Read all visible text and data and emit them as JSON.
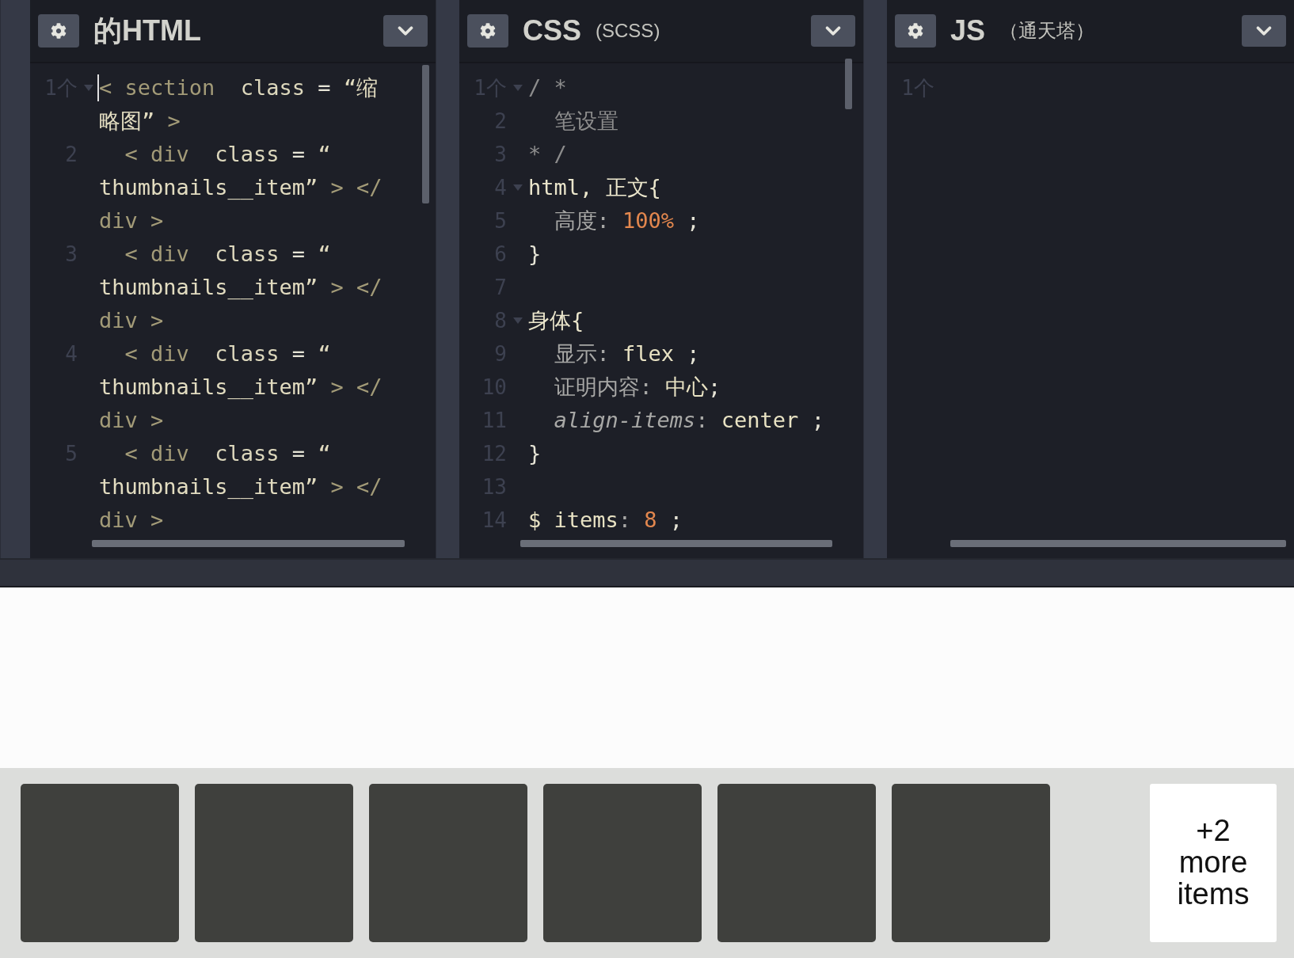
{
  "editors": [
    {
      "title": "的HTML",
      "lines": [
        {
          "number": "1个",
          "fold": true,
          "cursor": true,
          "rows": [
            {
              "segments": [
                {
                  "kind": "tag",
                  "text": "< section  "
                },
                {
                  "kind": "attr",
                  "text": "class"
                },
                {
                  "kind": "punct",
                  "text": " = "
                },
                {
                  "kind": "string",
                  "text": "“缩"
                }
              ]
            },
            {
              "segments": [
                {
                  "kind": "string",
                  "text": "略图”"
                },
                {
                  "kind": "tag",
                  "text": " >"
                }
              ]
            }
          ]
        },
        {
          "number": "2",
          "fold": false,
          "cursor": false,
          "rows": [
            {
              "segments": [
                {
                  "kind": "tag",
                  "text": "  < div  "
                },
                {
                  "kind": "attr",
                  "text": "class"
                },
                {
                  "kind": "punct",
                  "text": " = "
                },
                {
                  "kind": "string",
                  "text": "“"
                }
              ]
            },
            {
              "segments": [
                {
                  "kind": "string",
                  "text": "thumbnails__item”"
                },
                {
                  "kind": "tag",
                  "text": " > </"
                }
              ]
            },
            {
              "segments": [
                {
                  "kind": "tag",
                  "text": "div >"
                }
              ]
            }
          ]
        },
        {
          "number": "3",
          "fold": false,
          "cursor": false,
          "rows": [
            {
              "segments": [
                {
                  "kind": "tag",
                  "text": "  < div  "
                },
                {
                  "kind": "attr",
                  "text": "class"
                },
                {
                  "kind": "punct",
                  "text": " = "
                },
                {
                  "kind": "string",
                  "text": "“"
                }
              ]
            },
            {
              "segments": [
                {
                  "kind": "string",
                  "text": "thumbnails__item”"
                },
                {
                  "kind": "tag",
                  "text": " > </"
                }
              ]
            },
            {
              "segments": [
                {
                  "kind": "tag",
                  "text": "div >"
                }
              ]
            }
          ]
        },
        {
          "number": "4",
          "fold": false,
          "cursor": false,
          "rows": [
            {
              "segments": [
                {
                  "kind": "tag",
                  "text": "  < div  "
                },
                {
                  "kind": "attr",
                  "text": "class"
                },
                {
                  "kind": "punct",
                  "text": " = "
                },
                {
                  "kind": "string",
                  "text": "“"
                }
              ]
            },
            {
              "segments": [
                {
                  "kind": "string",
                  "text": "thumbnails__item”"
                },
                {
                  "kind": "tag",
                  "text": " > </"
                }
              ]
            },
            {
              "segments": [
                {
                  "kind": "tag",
                  "text": "div >"
                }
              ]
            }
          ]
        },
        {
          "number": "5",
          "fold": false,
          "cursor": false,
          "rows": [
            {
              "segments": [
                {
                  "kind": "tag",
                  "text": "  < div  "
                },
                {
                  "kind": "attr",
                  "text": "class"
                },
                {
                  "kind": "punct",
                  "text": " = "
                },
                {
                  "kind": "string",
                  "text": "“"
                }
              ]
            },
            {
              "segments": [
                {
                  "kind": "string",
                  "text": "thumbnails__item”"
                },
                {
                  "kind": "tag",
                  "text": " > </"
                }
              ]
            },
            {
              "segments": [
                {
                  "kind": "tag",
                  "text": "div >"
                }
              ]
            }
          ]
        }
      ]
    },
    {
      "title": "CSS",
      "subtitle": "(SCSS)",
      "lines": [
        {
          "number": "1个",
          "fold": true,
          "cursor": false,
          "rows": [
            {
              "segments": [
                {
                  "kind": "comment",
                  "text": "/ *"
                }
              ]
            }
          ]
        },
        {
          "number": "2",
          "fold": false,
          "cursor": false,
          "rows": [
            {
              "segments": [
                {
                  "kind": "comment",
                  "text": "  笔设置"
                }
              ]
            }
          ]
        },
        {
          "number": "3",
          "fold": false,
          "cursor": false,
          "rows": [
            {
              "segments": [
                {
                  "kind": "comment",
                  "text": "* /"
                }
              ]
            }
          ]
        },
        {
          "number": "4",
          "fold": true,
          "cursor": false,
          "rows": [
            {
              "segments": [
                {
                  "kind": "selector",
                  "text": "html, 正文{"
                }
              ]
            }
          ]
        },
        {
          "number": "5",
          "fold": false,
          "cursor": false,
          "rows": [
            {
              "segments": [
                {
                  "kind": "property",
                  "text": "  高度: "
                },
                {
                  "kind": "number",
                  "text": "100%"
                },
                {
                  "kind": "punct",
                  "text": " ;"
                }
              ]
            }
          ]
        },
        {
          "number": "6",
          "fold": false,
          "cursor": false,
          "rows": [
            {
              "segments": [
                {
                  "kind": "punct",
                  "text": "}"
                }
              ]
            }
          ]
        },
        {
          "number": "7",
          "fold": false,
          "cursor": false
        },
        {
          "number": "8",
          "fold": true,
          "cursor": false,
          "rows": [
            {
              "segments": [
                {
                  "kind": "selector",
                  "text": "身体{"
                }
              ]
            }
          ]
        },
        {
          "number": "9",
          "fold": false,
          "cursor": false,
          "rows": [
            {
              "segments": [
                {
                  "kind": "property",
                  "text": "  显示: "
                },
                {
                  "kind": "value",
                  "text": "flex"
                },
                {
                  "kind": "punct",
                  "text": " ;"
                }
              ]
            }
          ]
        },
        {
          "number": "10",
          "fold": false,
          "cursor": false,
          "rows": [
            {
              "segments": [
                {
                  "kind": "property",
                  "text": "  证明内容: "
                },
                {
                  "kind": "value",
                  "text": "中心"
                },
                {
                  "kind": "punct",
                  "text": ";"
                }
              ]
            }
          ]
        },
        {
          "number": "11",
          "fold": false,
          "cursor": false,
          "rows": [
            {
              "segments": [
                {
                  "kind": "prop_em",
                  "text": "  align-items"
                },
                {
                  "kind": "property",
                  "text": ": "
                },
                {
                  "kind": "value",
                  "text": "center"
                },
                {
                  "kind": "punct",
                  "text": " ;"
                }
              ]
            }
          ]
        },
        {
          "number": "12",
          "fold": false,
          "cursor": false,
          "rows": [
            {
              "segments": [
                {
                  "kind": "punct",
                  "text": "}"
                }
              ]
            }
          ]
        },
        {
          "number": "13",
          "fold": false,
          "cursor": false
        },
        {
          "number": "14",
          "fold": false,
          "cursor": false,
          "rows": [
            {
              "segments": [
                {
                  "kind": "value",
                  "text": "$ items"
                },
                {
                  "kind": "property",
                  "text": ": "
                },
                {
                  "kind": "number",
                  "text": "8"
                },
                {
                  "kind": "punct",
                  "text": " ;"
                }
              ]
            }
          ]
        }
      ]
    },
    {
      "title": "JS",
      "subtitle": "（通天塔）",
      "lines": [
        {
          "number": "1个",
          "fold": false,
          "cursor": false
        }
      ]
    }
  ],
  "thumbnails": [
    {
      "kind": "tile"
    },
    {
      "kind": "tile"
    },
    {
      "kind": "tile"
    },
    {
      "kind": "tile"
    },
    {
      "kind": "tile"
    },
    {
      "kind": "tile"
    },
    {
      "kind": "more",
      "label": "+2 more items"
    }
  ]
}
